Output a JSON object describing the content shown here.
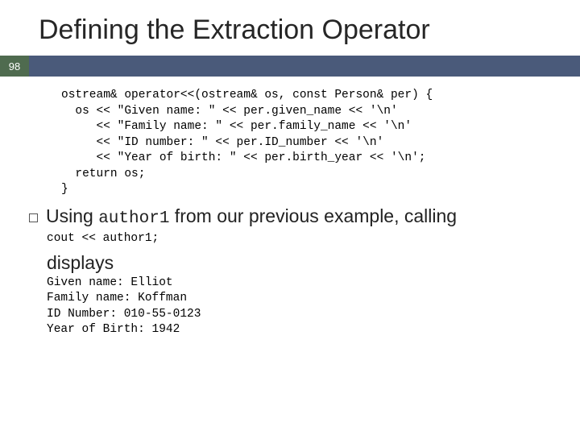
{
  "title": "Defining the Extraction Operator",
  "page_number": "98",
  "code": {
    "l1": "ostream& operator<<(ostream& os, const Person& per) {",
    "l2": "  os << \"Given name: \" << per.given_name << '\\n'",
    "l3": "     << \"Family name: \" << per.family_name << '\\n'",
    "l4": "     << \"ID number: \" << per.ID_number << '\\n'",
    "l5": "     << \"Year of birth: \" << per.birth_year << '\\n';",
    "l6": "  return os;",
    "l7": "}"
  },
  "bullet": {
    "pre": "Using ",
    "mono": "author1",
    "post": " from our previous example, calling"
  },
  "call_line": "cout << author1;",
  "displays_label": "displays",
  "output": {
    "l1": "Given name: Elliot",
    "l2": "Family name: Koffman",
    "l3": "ID Number: 010-55-0123",
    "l4": "Year of Birth: 1942"
  }
}
